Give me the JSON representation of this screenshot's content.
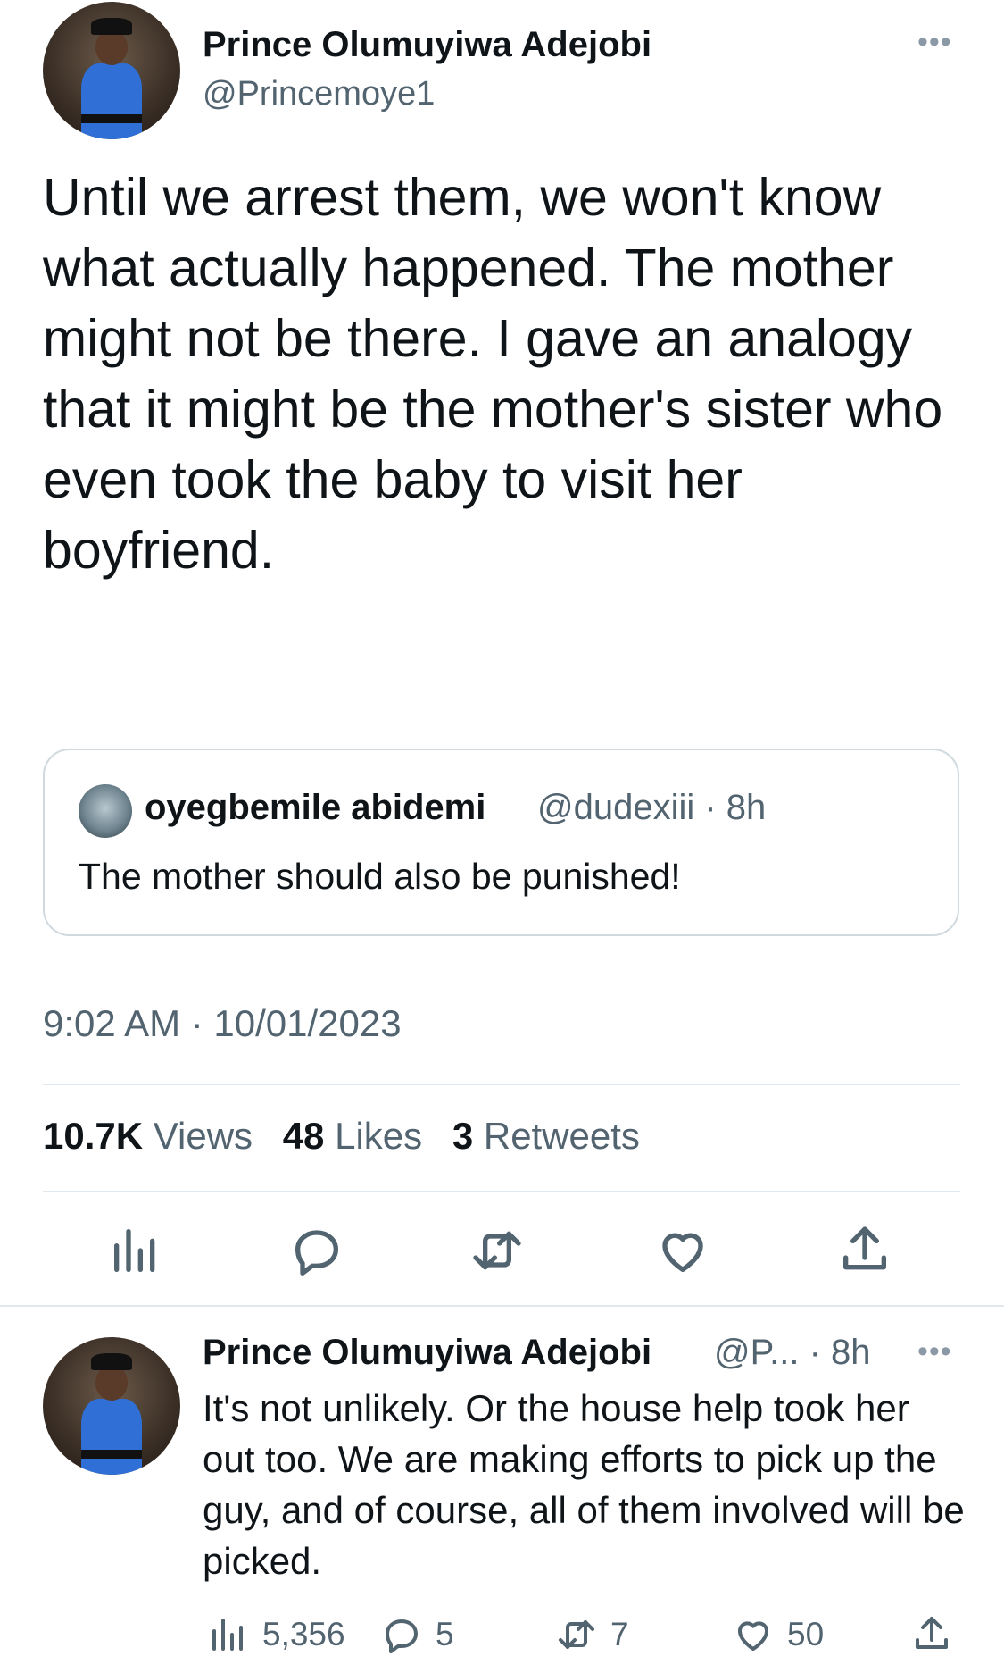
{
  "tweet": {
    "author_name": "Prince Olumuyiwa Adejobi",
    "author_handle": "@Princemoye1",
    "more_icon": "more-horizontal-icon",
    "text": "Until we arrest them, we won't know what actually happened. The mother might not be there. I gave an analogy that it might be the mother's sister who even took the baby to visit her boyfriend.",
    "quote": {
      "author_name": "oyegbemile abidemi",
      "meta": "@dudexiii · 8h",
      "text": "The mother should also be punished!"
    },
    "timestamp": "9:02 AM · 10/01/2023",
    "stats": {
      "views_num": "10.7K",
      "views_label": "Views",
      "likes_num": "48",
      "likes_label": "Likes",
      "retweets_num": "3",
      "retweets_label": "Retweets"
    },
    "actions": [
      "views-icon",
      "reply-icon",
      "retweet-icon",
      "like-icon",
      "share-icon"
    ]
  },
  "reply": {
    "author_name": "Prince Olumuyiwa Adejobi",
    "meta": "@P... · 8h",
    "text": "It's not unlikely. Or the house help took her out too. We are making efforts to pick up the guy, and of course, all of them involved will be picked.",
    "views_count": "5,356",
    "replies_count": "5",
    "retweets_count": "7",
    "likes_count": "50"
  },
  "colors": {
    "text_primary": "#0f1419",
    "text_secondary": "#536471",
    "border": "#cfd9de",
    "divider": "#e1e8ed"
  }
}
